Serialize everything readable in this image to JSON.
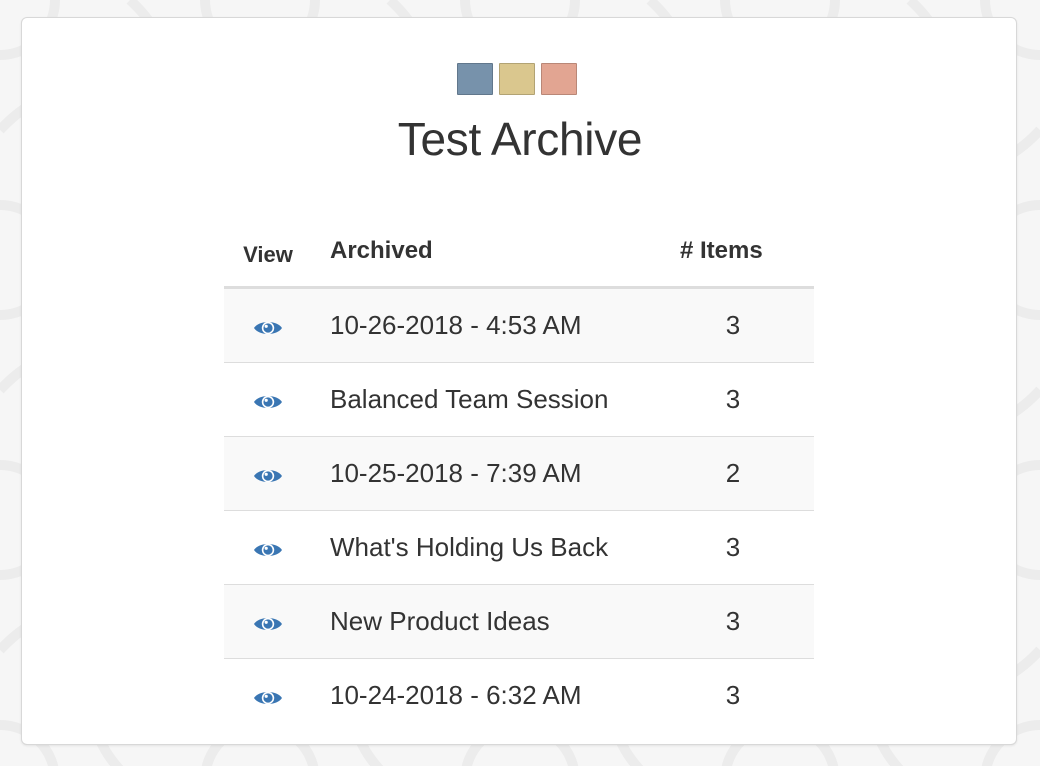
{
  "page": {
    "title": "Test Archive"
  },
  "logo": {
    "colors": [
      "#7792ab",
      "#dac78e",
      "#e2a592"
    ]
  },
  "table": {
    "headers": {
      "view": "View",
      "archived": "Archived",
      "items": "# Items"
    },
    "view_icon": "eye-icon",
    "rows": [
      {
        "archived": "10-26-2018 - 4:53 AM",
        "items": "3"
      },
      {
        "archived": "Balanced Team Session",
        "items": "3"
      },
      {
        "archived": "10-25-2018 - 7:39 AM",
        "items": "2"
      },
      {
        "archived": "What's Holding Us Back",
        "items": "3"
      },
      {
        "archived": "New Product Ideas",
        "items": "3"
      },
      {
        "archived": "10-24-2018 - 6:32 AM",
        "items": "3"
      }
    ]
  },
  "colors": {
    "accent_icon": "#3a76b3",
    "row_stripe": "#f9f9f9",
    "border": "#dddddd",
    "text": "#333333"
  }
}
